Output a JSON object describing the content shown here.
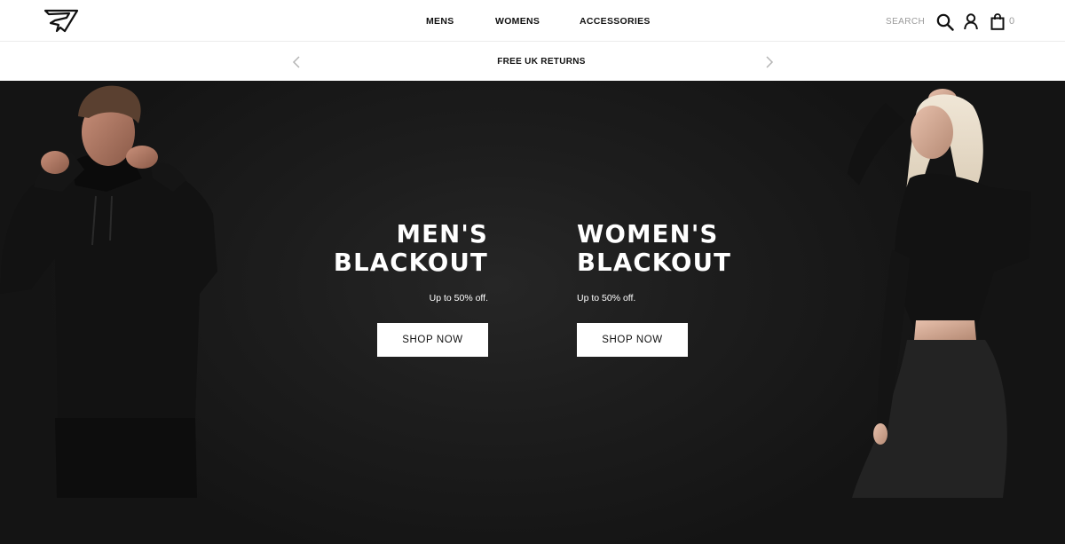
{
  "header": {
    "logo_icon": "gymshark-logo-icon",
    "nav": {
      "mens": "MENS",
      "womens": "WOMENS",
      "accessories": "ACCESSORIES"
    },
    "search": {
      "placeholder": "SEARCH",
      "icon": "search-icon"
    },
    "account_icon": "user-icon",
    "bag": {
      "icon": "shopping-bag-icon",
      "count": "0"
    }
  },
  "promo": {
    "text": "FREE UK RETURNS",
    "prev_icon": "chevron-left-icon",
    "next_icon": "chevron-right-icon"
  },
  "hero": {
    "mens": {
      "title_line1": "MEN'S",
      "title_line2": "BLACKOUT",
      "subtitle": "Up to 50% off.",
      "cta": "SHOP NOW"
    },
    "womens": {
      "title_line1": "WOMEN'S",
      "title_line2": "BLACKOUT",
      "subtitle": "Up to 50% off.",
      "cta": "SHOP NOW"
    }
  },
  "colors": {
    "header_bg": "#ffffff",
    "hero_bg": "#1d1d1d",
    "text_dark": "#111111",
    "muted": "#9a9a9a",
    "button_bg": "#ffffff"
  }
}
